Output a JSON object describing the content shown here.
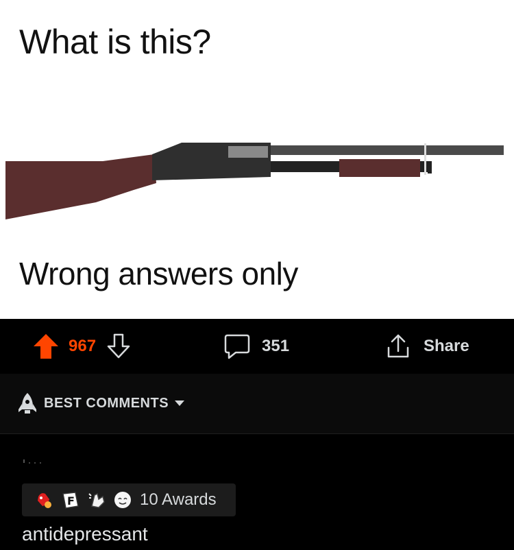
{
  "post": {
    "image_line_1": "What is this?",
    "image_line_2": "Wrong answers only",
    "colors": {
      "stock": "#5a2e2e",
      "receiver": "#2f2f2f",
      "barrel": "#4a4a4a"
    }
  },
  "actions": {
    "upvote_icon": "upvote-arrow-icon",
    "score": "967",
    "downvote_icon": "downvote-arrow-icon",
    "comment_icon": "comment-bubble-icon",
    "comment_count": "351",
    "share_icon": "share-upload-icon",
    "share_label": "Share"
  },
  "comments_sort": {
    "icon": "rocket-icon",
    "label": "BEST COMMENTS",
    "caret_icon": "caret-down-icon"
  },
  "comment": {
    "awards": {
      "icons": [
        "rocket-like-award-icon",
        "press-f-award-icon",
        "bless-up-award-icon",
        "wholesome-award-icon"
      ],
      "label": "10 Awards"
    },
    "text": "antidepressant"
  },
  "theme": {
    "accent": "#ff4500",
    "text": "#d7dadc",
    "background": "#000000"
  }
}
